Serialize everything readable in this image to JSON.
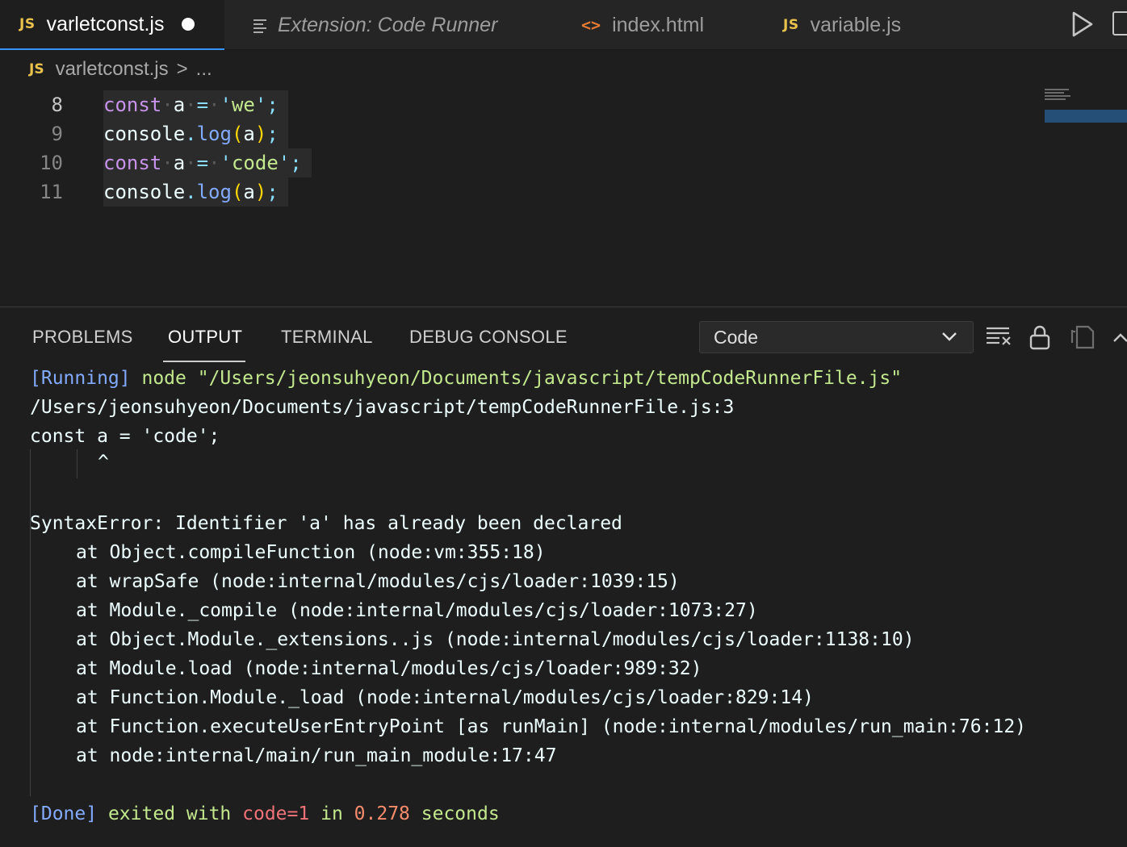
{
  "tabs": [
    {
      "label": "varletconst.js",
      "badge": "JS",
      "active": true,
      "dirty": true
    },
    {
      "label": "Extension: Code Runner",
      "badge": "",
      "active": false
    },
    {
      "label": "index.html",
      "badge": "<>",
      "active": false
    },
    {
      "label": "variable.js",
      "badge": "JS",
      "active": false
    }
  ],
  "breadcrumb": {
    "badge": "JS",
    "file": "varletconst.js",
    "separator": ">",
    "rest": "..."
  },
  "editor": {
    "line_numbers": [
      "8",
      "9",
      "10",
      "11"
    ],
    "lines": [
      "const a = 'we';",
      "console.log(a);",
      "const a = 'code';",
      "console.log(a);"
    ]
  },
  "panel": {
    "tabs": [
      "PROBLEMS",
      "OUTPUT",
      "TERMINAL",
      "DEBUG CONSOLE"
    ],
    "active_tab": "OUTPUT",
    "output_channel": "Code"
  },
  "output": {
    "running_tag": "[Running]",
    "running_cmd": "node \"/Users/jeonsuhyeon/Documents/javascript/tempCodeRunnerFile.js\"",
    "error_location": "/Users/jeonsuhyeon/Documents/javascript/tempCodeRunnerFile.js:3",
    "error_source": "const a = 'code';",
    "caret": "^",
    "error_message": "SyntaxError: Identifier 'a' has already been declared",
    "stack": [
      "at Object.compileFunction (node:vm:355:18)",
      "at wrapSafe (node:internal/modules/cjs/loader:1039:15)",
      "at Module._compile (node:internal/modules/cjs/loader:1073:27)",
      "at Object.Module._extensions..js (node:internal/modules/cjs/loader:1138:10)",
      "at Module.load (node:internal/modules/cjs/loader:989:32)",
      "at Function.Module._load (node:internal/modules/cjs/loader:829:14)",
      "at Function.executeUserEntryPoint [as runMain] (node:internal/modules/run_main:76:12)",
      "at node:internal/main/run_main_module:17:47"
    ],
    "done_tag": "[Done]",
    "done_text1": "exited with",
    "done_code": "code=1",
    "done_text2": "in",
    "done_time": "0.278",
    "done_text3": "seconds"
  },
  "colors": {
    "accent": "#3794ff",
    "keyword": "#c792ea",
    "string": "#c3e88d",
    "function": "#82aaff",
    "error": "#f07178",
    "number": "#f78c6c"
  }
}
